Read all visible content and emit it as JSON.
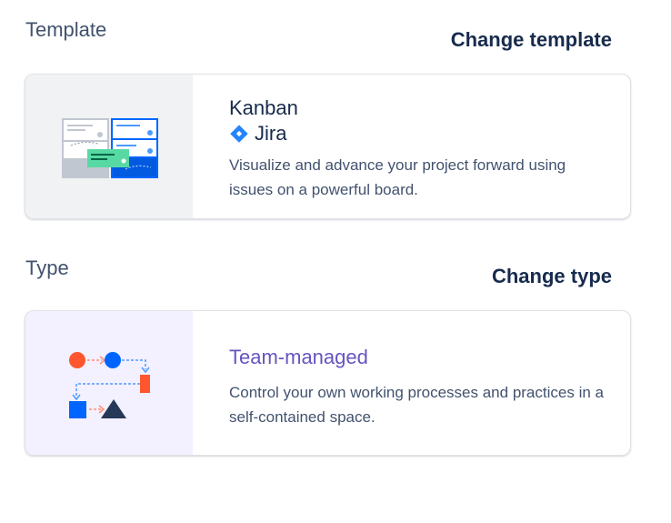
{
  "template_section": {
    "label": "Template",
    "change_label": "Change template",
    "card": {
      "title": "Kanban",
      "product": "Jira",
      "description": "Visualize and advance your project forward using issues on a powerful board."
    }
  },
  "type_section": {
    "label": "Type",
    "change_label": "Change type",
    "card": {
      "title": "Team-managed",
      "description": "Control your own working processes and practices in a self-contained space."
    }
  },
  "colors": {
    "jira_blue": "#2684ff",
    "team_managed_purple": "#6554c0",
    "illustration_red": "#ff5630",
    "illustration_blue": "#0065ff",
    "illustration_green": "#57d9a3",
    "illustration_navy": "#253858"
  },
  "icons": {
    "kanban_illustration": "kanban-board-illustration",
    "product_logo": "jira-logo-icon",
    "type_illustration": "team-managed-workflow-illustration"
  }
}
